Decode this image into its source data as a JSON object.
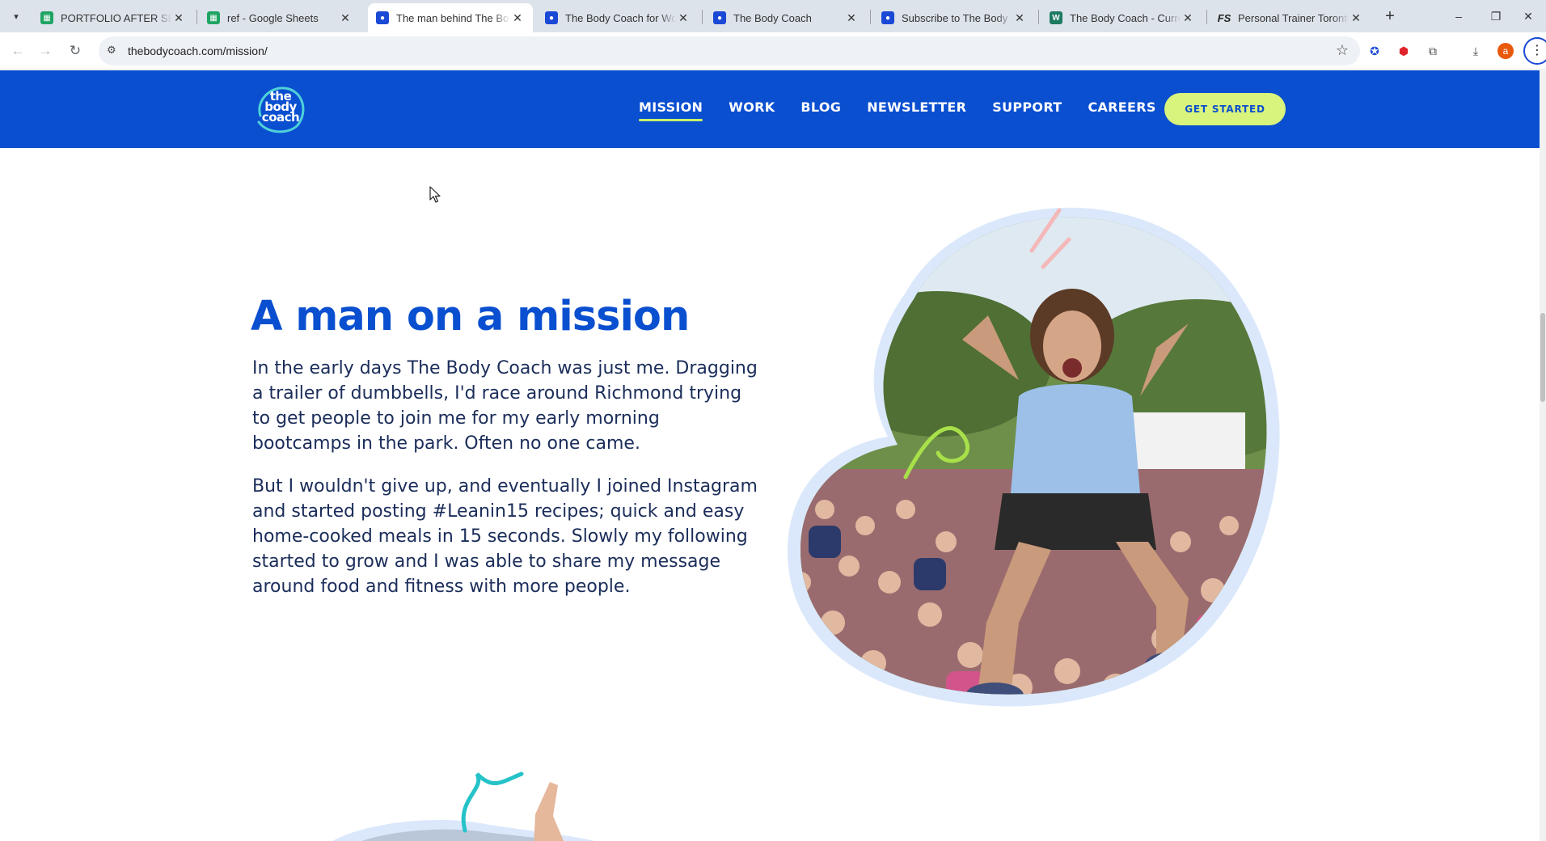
{
  "browser": {
    "tabs": [
      {
        "title": "PORTFOLIO AFTER SELLING",
        "icon": "sheets-icon",
        "active": false
      },
      {
        "title": "ref - Google Sheets",
        "icon": "sheets-icon",
        "active": false
      },
      {
        "title": "The man behind The Body Coach",
        "icon": "bodycoach-icon",
        "active": true
      },
      {
        "title": "The Body Coach for Work",
        "icon": "bodycoach-icon",
        "active": false
      },
      {
        "title": "The Body Coach",
        "icon": "bodycoach-icon",
        "active": false
      },
      {
        "title": "Subscribe to The Body Coach",
        "icon": "bodycoach-icon",
        "active": false
      },
      {
        "title": "The Body Coach - Current",
        "icon": "word-icon",
        "active": false
      },
      {
        "title": "Personal Trainer Toronto",
        "icon": "fs-icon",
        "active": false
      }
    ],
    "url": "thebodycoach.com/mission/",
    "profile_initial": "a",
    "new_tab_glyph": "+",
    "close_glyph": "✕"
  },
  "site": {
    "logo": {
      "line1": "the",
      "line2": "body",
      "line3": "coach"
    },
    "nav": [
      {
        "label": "MISSION",
        "active": true
      },
      {
        "label": "WORK",
        "active": false
      },
      {
        "label": "BLOG",
        "active": false
      },
      {
        "label": "NEWSLETTER",
        "active": false
      },
      {
        "label": "SUPPORT",
        "active": false
      },
      {
        "label": "CAREERS",
        "active": false
      }
    ],
    "cta_label": "GET STARTED"
  },
  "content": {
    "headline": "A man on a mission",
    "paragraph1": "In the early days The Body Coach was just me. Dragging a trailer of dumbbells, I'd race around Richmond trying to get people to join me for my early morning bootcamps in the park. Often no one came.",
    "paragraph2": "But I wouldn't give up, and eventually I joined Instagram and started posting #Leanin15 recipes; quick and easy home-cooked meals in 15 seconds. Slowly my following started to grow and I was able to share my message around food and fitness with more people."
  },
  "colors": {
    "brand_blue": "#0a4fd0",
    "cta_green": "#d8f47c",
    "body_text": "#1b2d5a",
    "tab_strip": "#dde3ea"
  }
}
